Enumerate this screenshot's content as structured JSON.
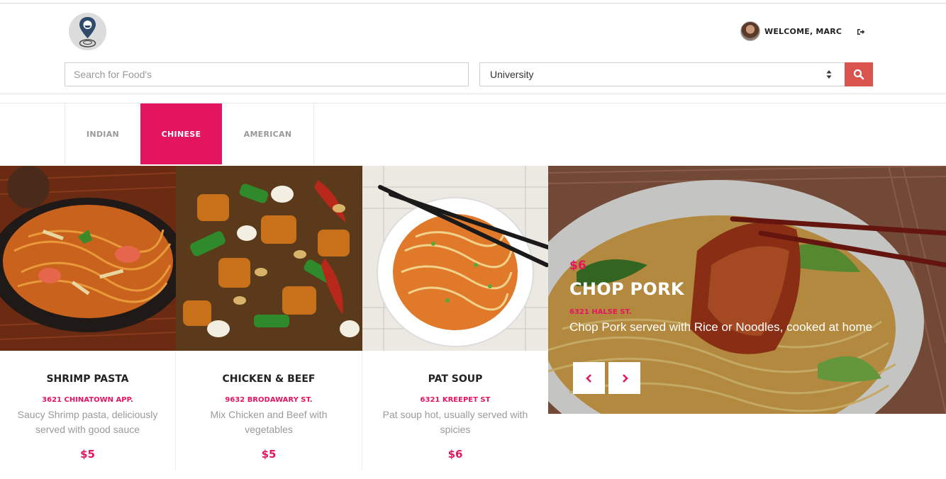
{
  "header": {
    "logo": "map-pin-food-logo",
    "welcome_text": "WELCOME, MARC",
    "logout_icon": "sign-out-icon"
  },
  "search": {
    "placeholder": "Search for Food's",
    "location_selected": "University",
    "button_icon": "search-icon"
  },
  "tabs": [
    {
      "label": "INDIAN",
      "active": false
    },
    {
      "label": "CHINESE",
      "active": true
    },
    {
      "label": "AMERICAN",
      "active": false
    }
  ],
  "cards": [
    {
      "title": "SHRIMP PASTA",
      "address": "3621 CHINATOWN APP.",
      "description": "Saucy Shrimp pasta, deliciously served with good sauce",
      "price": "$5"
    },
    {
      "title": "CHICKEN & BEEF",
      "address": "9632 BRODAWARY ST.",
      "description": "Mix Chicken and Beef with vegetables",
      "price": "$5"
    },
    {
      "title": "PAT SOUP",
      "address": "6321 KREEPET ST",
      "description": "Pat soup hot, usually served with spicies",
      "price": "$6"
    }
  ],
  "featured": {
    "price": "$6",
    "title": "CHOP PORK",
    "address": "6321 HALSE ST.",
    "description": "Chop Pork served with Rice or Noodles, cooked at home",
    "prev_icon": "chevron-left-icon",
    "next_icon": "chevron-right-icon"
  },
  "colors": {
    "accent": "#e3155f",
    "search_button": "#d9534f"
  }
}
